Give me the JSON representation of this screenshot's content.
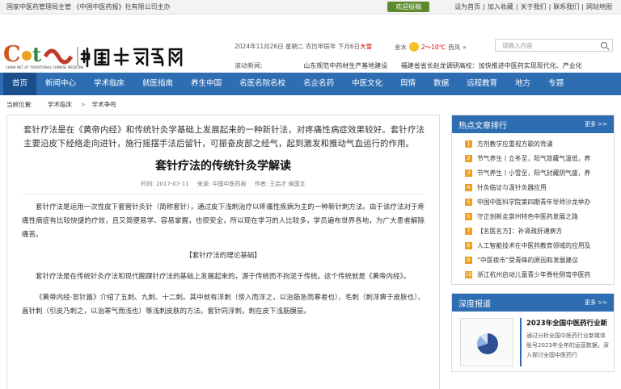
{
  "topbar": {
    "owner": "国家中医药管理局主管 《中国中医药报》社有限公司主办",
    "welcome": "欢迎投稿",
    "links": [
      "设为首页",
      "加入收藏",
      "关于我们",
      "联系我们",
      "网站地图"
    ]
  },
  "header": {
    "date": "2024年11月26日 星期二 农历甲辰年 下月6日",
    "solar_term": "大雪",
    "weather_city": "金水",
    "weather_temp": "2～10℃",
    "weather_wind": "西风",
    "search_placeholder": "请输入内容",
    "scroll_label": "滚动新闻:",
    "scroll_news": [
      "山东规范中药材生产基地建设",
      "福建省省长赵龙调研高校：加快推进中医药实现现代化、产业化"
    ]
  },
  "nav": [
    "首页",
    "新闻中心",
    "学术临床",
    "就医指南",
    "养生中国",
    "名医名院名校",
    "名企名药",
    "中医文化",
    "舆情",
    "数据",
    "远程教育",
    "地方",
    "专题"
  ],
  "breadcrumb": {
    "label": "当前位置:",
    "items": [
      "学术临床",
      "学术争鸣"
    ]
  },
  "article": {
    "lead": "套针疗法是在《黄帝内经》和传统针灸学基础上发展起来的一种新针法，对疼痛性病症效果较好。套针疗法主要沿皮下经络走向进针，施行摇摆手法后留针，可振奋皮部之经气，起到激发和推动气血运行的作用。",
    "title": "套针疗法的传统针灸学解读",
    "time": "时间: 2017-07-11",
    "source": "来源: 中国中医药报",
    "author": "作者: 王启才 侯国文",
    "p1": "套针疗法是运用一次性皮下套管针灸针（简称套针），通过皮下浅刺治疗以疼痛性疾病为主的一种新针刺方法。由于该疗法对于疼痛性病症有比较快捷的疗效，且又简便易学、容易掌握，也很安全，所以现在学习的人比较多，学员遍布世界各地，为广大患者解除痛苦。",
    "subtitle": "【套针疗法的理论基础】",
    "p2": "套针疗法是在传统针灸疗法和现代腕踝针疗法的基础上发展起来的，源于传统而不拘泥于传统。这个传统就是《黄帝内经》。",
    "p3": "《黄帝内经·官针篇》介绍了五刺、九刺、十二刺。其中就有浮刺（傍入而浮之，以治筋急而寒者也）、毛刺（刺浮痹于皮肤也）、直针刺（引皮乃刺之，以治寒气而浅也）等浅刺皮肤的方法。套针同浮刺，刺在皮下浅筋膜层。"
  },
  "sidebar": {
    "hot_title": "热点文章排行",
    "more": "更多 >>",
    "hot_items": [
      "方剂教学应重视方歌的背诵",
      "节气养生丨立冬至，阳气敛藏气温低，养",
      "节气养生丨小雪至，阳气封藏阴气盛，养",
      "针灸临证与温针灸器应用",
      "中国中医科学院第四期青年导师沙龙举办",
      "守正创新走崇州特色中医药发展之路",
      "【名医名方】：补肾疏肝通痹方",
      "人工智能技术在中医药教育领域的应用及",
      "“中医夜市”受青睐的原因和发展建议",
      "浙江杭州启动儿童青少年脊柱侧弯中医药"
    ],
    "deep_title": "深度报道",
    "deep_more": "更多 >>",
    "deep_item_title": "2023年全国中医药行业新",
    "deep_item_desc": "通过分析全国中医药行业新媒体账号2023年全年的运营数据，深入探讨全国中医药行"
  }
}
